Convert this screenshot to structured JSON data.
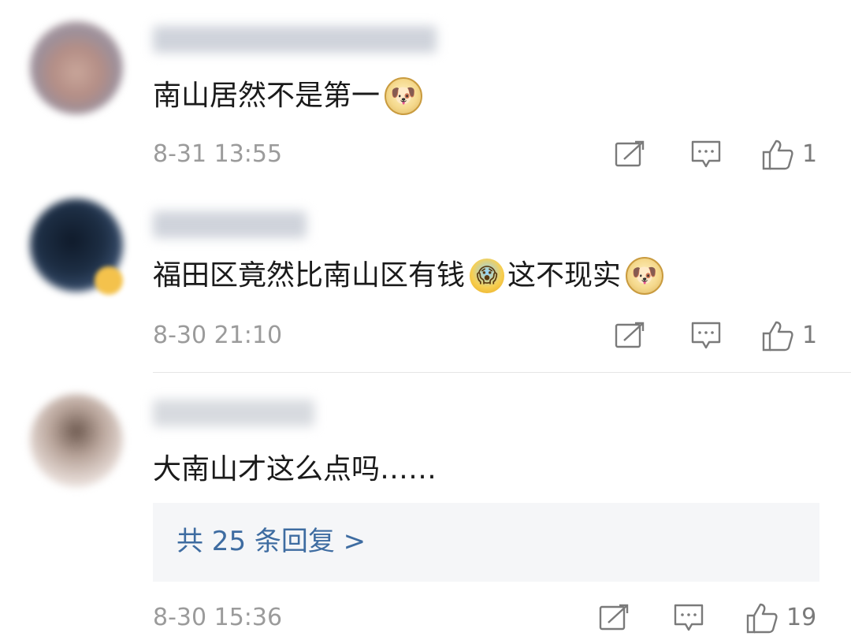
{
  "comments": [
    {
      "text": "南山居然不是第一",
      "emoji": [
        "doge"
      ],
      "timestamp": "8-31 13:55",
      "like_count": "1"
    },
    {
      "text": "福田区竟然比南山区有钱",
      "emoji_mid": "scream",
      "text_after": "这不现实",
      "emoji_end": "doge",
      "timestamp": "8-30 21:10",
      "like_count": "1"
    },
    {
      "text": "大南山才这么点吗……",
      "reply_link": "共 25 条回复 >",
      "timestamp": "8-30 15:36",
      "like_count": "19"
    }
  ],
  "icons": {
    "doge_emoji": "🐶",
    "scream_emoji": "😱",
    "repost": "repost-icon",
    "comment": "comment-icon",
    "like": "thumbs-up-icon"
  },
  "colors": {
    "text": "#1a1a1a",
    "meta": "#9b9b9b",
    "link": "#3e6ca1",
    "reply_bg": "#f5f6f8"
  }
}
